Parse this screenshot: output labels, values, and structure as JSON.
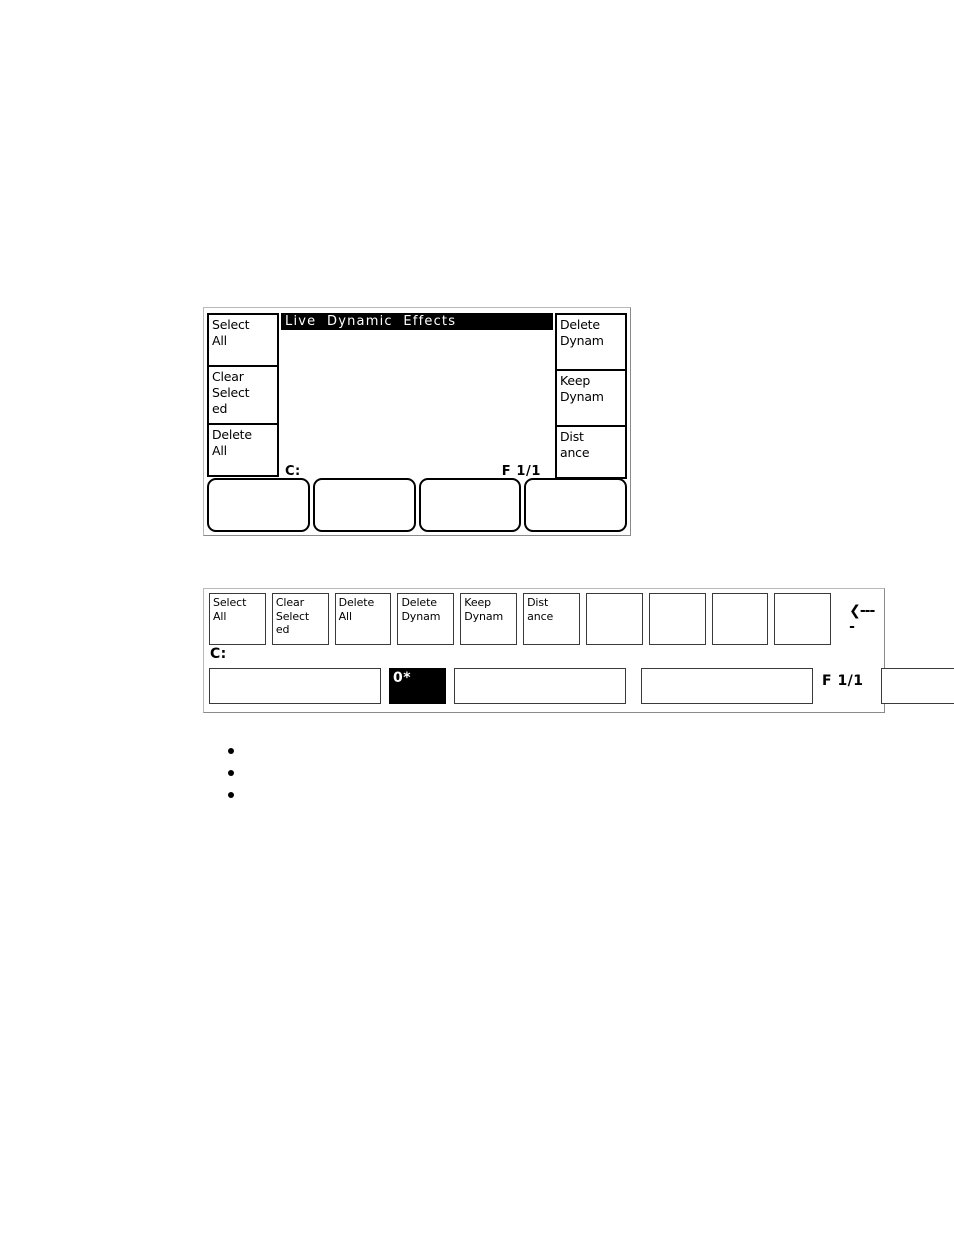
{
  "screen_panel": {
    "title": "Live  Dynamic  Effects",
    "status_prefix": "C:",
    "page_indicator": "F  1/1",
    "left_keys": [
      {
        "label": "Select\nAll"
      },
      {
        "label": "Clear\nSelect\ned"
      },
      {
        "label": "Delete\nAll"
      }
    ],
    "right_keys": [
      {
        "label": "Delete\nDynam"
      },
      {
        "label": "Keep\nDynam"
      },
      {
        "label": "Dist\nance"
      }
    ],
    "soft_buttons": [
      {
        "label": ""
      },
      {
        "label": ""
      },
      {
        "label": ""
      },
      {
        "label": ""
      }
    ]
  },
  "keymap_panel": {
    "status_prefix": "C:",
    "page_indicator": "F 1/1",
    "back_arrow": "❮----",
    "keys": [
      {
        "label": "Select\nAll"
      },
      {
        "label": "Clear\nSelect\ned"
      },
      {
        "label": "Delete\nAll"
      },
      {
        "label": "Delete\nDynam"
      },
      {
        "label": "Keep\nDynam"
      },
      {
        "label": "Dist\nance"
      },
      {
        "label": ""
      },
      {
        "label": ""
      },
      {
        "label": ""
      },
      {
        "label": ""
      }
    ],
    "fields": [
      {
        "value": "",
        "inverted": false
      },
      {
        "value": "0*",
        "inverted": true
      },
      {
        "value": "",
        "inverted": false
      },
      {
        "value": "",
        "inverted": false
      },
      {
        "value": "",
        "inverted": false
      }
    ]
  },
  "bullets": [
    {
      "text": ""
    },
    {
      "text": ""
    },
    {
      "text": ""
    }
  ],
  "colors": {
    "panel_border": "#b9b9b9",
    "key_border": "#3a3a3a",
    "lcd_ink": "#000000",
    "lcd_paper": "#ffffff",
    "inverted_bg": "#000000"
  }
}
